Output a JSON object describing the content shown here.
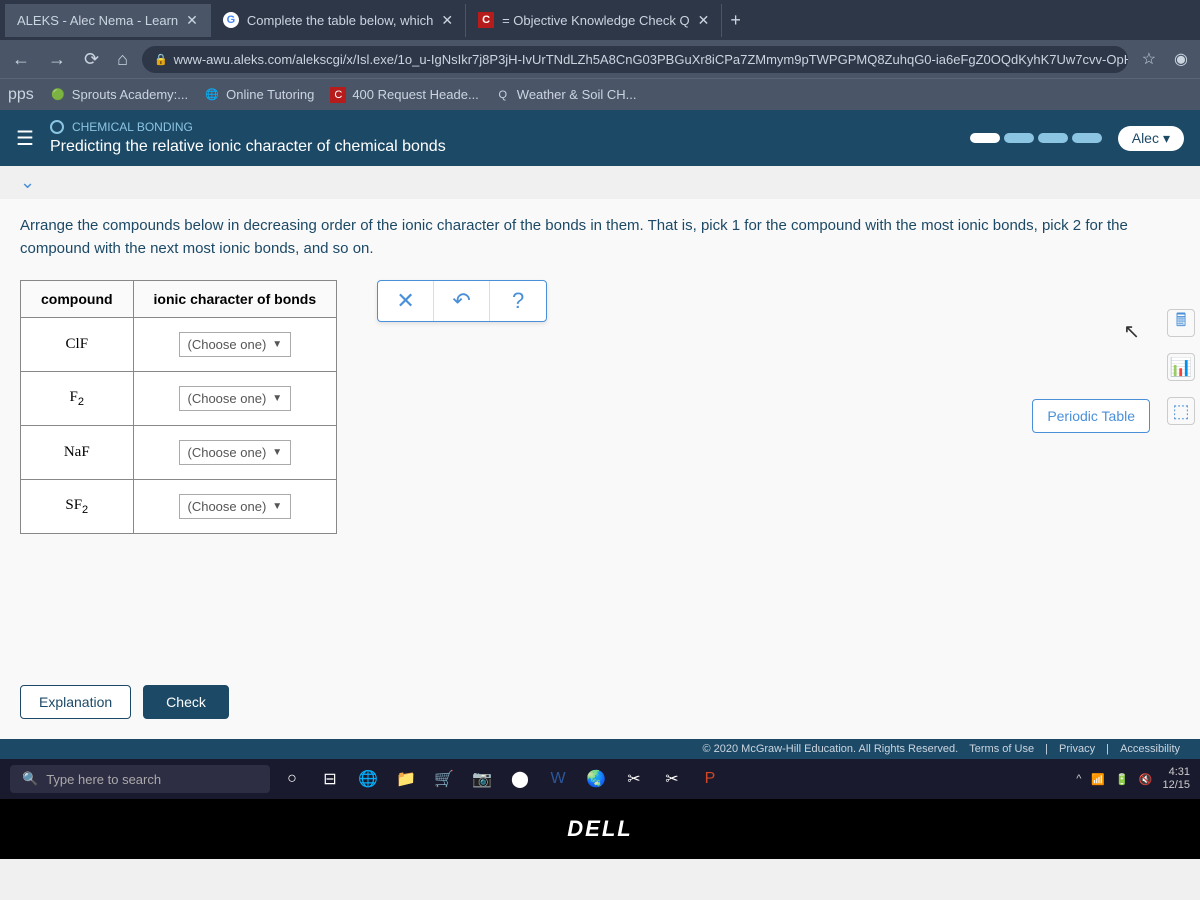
{
  "tabs": [
    {
      "title": "ALEKS - Alec Nema - Learn"
    },
    {
      "title": "Complete the table below, which"
    },
    {
      "title": "= Objective Knowledge Check Q"
    }
  ],
  "url": "www-awu.aleks.com/alekscgi/x/Isl.exe/1o_u-IgNsIkr7j8P3jH-IvUrTNdLZh5A8CnG03PBGuXr8iCPa7ZMmym9pTWPGPMQ8ZuhqG0-ia6eFgZ0OQdKyhK7Uw7cvv-OpH...",
  "bookmarks": {
    "label_apps": "pps",
    "items": [
      {
        "label": "Sprouts Academy:..."
      },
      {
        "label": "Online Tutoring"
      },
      {
        "label": "400 Request Heade..."
      },
      {
        "label": "Weather & Soil CH..."
      }
    ]
  },
  "aleks": {
    "category": "CHEMICAL BONDING",
    "title": "Predicting the relative ionic character of chemical bonds",
    "user": "Alec"
  },
  "instructions": "Arrange the compounds below in decreasing order of the ionic character of the bonds in them. That is, pick 1 for the compound with the most ionic bonds, pick 2 for the compound with the next most ionic bonds, and so on.",
  "table": {
    "header_compound": "compound",
    "header_ionic": "ionic character of bonds",
    "rows": [
      {
        "compound": "ClF",
        "value": "(Choose one)"
      },
      {
        "compound_html": "F<sub>2</sub>",
        "compound": "F2",
        "value": "(Choose one)"
      },
      {
        "compound": "NaF",
        "value": "(Choose one)"
      },
      {
        "compound_html": "SF<sub>2</sub>",
        "compound": "SF2",
        "value": "(Choose one)"
      }
    ]
  },
  "actions": {
    "clear": "✕",
    "undo": "↶",
    "help": "?"
  },
  "periodic_table": "Periodic Table",
  "buttons": {
    "explanation": "Explanation",
    "check": "Check"
  },
  "footer": {
    "copyright": "© 2020 McGraw-Hill Education. All Rights Reserved.",
    "terms": "Terms of Use",
    "privacy": "Privacy",
    "accessibility": "Accessibility"
  },
  "taskbar": {
    "search_placeholder": "Type here to search",
    "time": "4:31",
    "date": "12/15"
  },
  "dell": "DELL"
}
